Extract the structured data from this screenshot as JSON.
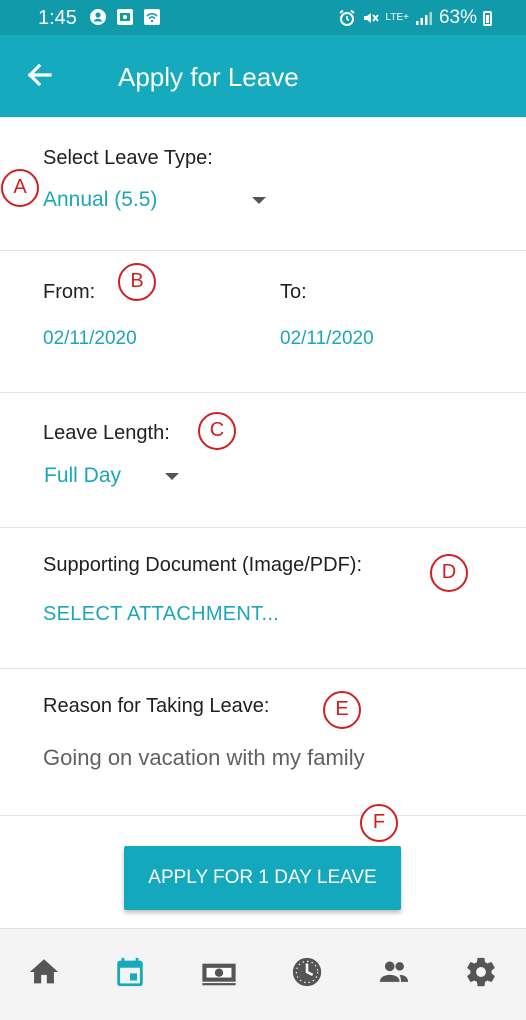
{
  "status_bar": {
    "time": "1:45",
    "network": "LTE+",
    "battery": "63%"
  },
  "app_bar": {
    "title": "Apply for Leave"
  },
  "leave_type": {
    "label": "Select Leave Type:",
    "value": "Annual (5.5)",
    "marker": "A"
  },
  "dates": {
    "from_label": "From:",
    "from_value": "02/11/2020",
    "to_label": "To:",
    "to_value": "02/11/2020",
    "marker": "B"
  },
  "leave_length": {
    "label": "Leave Length:",
    "value": "Full Day",
    "marker": "C"
  },
  "document": {
    "label": "Supporting Document (Image/PDF):",
    "action": "SELECT ATTACHMENT...",
    "marker": "D"
  },
  "reason": {
    "label": "Reason for Taking Leave:",
    "value": "Going on vacation with my family",
    "marker": "E"
  },
  "apply": {
    "label": "APPLY FOR 1 DAY LEAVE",
    "marker": "F"
  },
  "bottom_nav": {
    "items": [
      {
        "icon": "home-icon",
        "active": false
      },
      {
        "icon": "calendar-icon",
        "active": true
      },
      {
        "icon": "money-icon",
        "active": false
      },
      {
        "icon": "clock-icon",
        "active": false
      },
      {
        "icon": "people-icon",
        "active": false
      },
      {
        "icon": "gear-icon",
        "active": false
      }
    ]
  },
  "colors": {
    "primary": "#16aabf",
    "status_bar": "#119aaa",
    "link": "#1ba6ba",
    "marker": "#d22020",
    "nav_active": "#16aabf",
    "nav_inactive": "#555555"
  }
}
